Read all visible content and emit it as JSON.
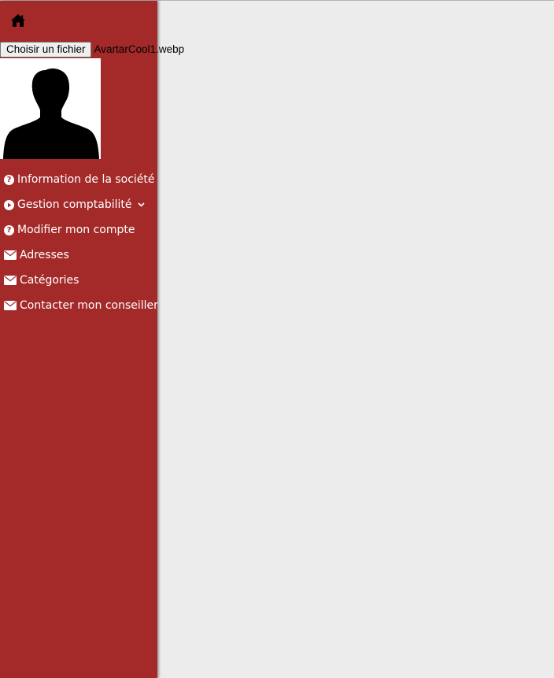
{
  "header": {
    "home_icon": "home-icon"
  },
  "upload": {
    "button_label": "Choisir un fichier",
    "file_name": "AvartarCool1.webp"
  },
  "avatar": {
    "icon": "user-silhouette-icon"
  },
  "sidebar": {
    "bg_color": "#a42a2a",
    "items": [
      {
        "label": "Information de la société",
        "icon": "question-circle-icon"
      },
      {
        "label": "Gestion comptabilité",
        "icon": "play-circle-icon",
        "has_dropdown": true
      },
      {
        "label": "Modifier mon compte",
        "icon": "question-circle-icon"
      },
      {
        "label": "Adresses",
        "icon": "envelope-icon"
      },
      {
        "label": "Catégories",
        "icon": "envelope-icon"
      },
      {
        "label": "Contacter mon conseiller",
        "icon": "envelope-icon"
      }
    ]
  },
  "main": {
    "bg_color": "#ececec"
  }
}
